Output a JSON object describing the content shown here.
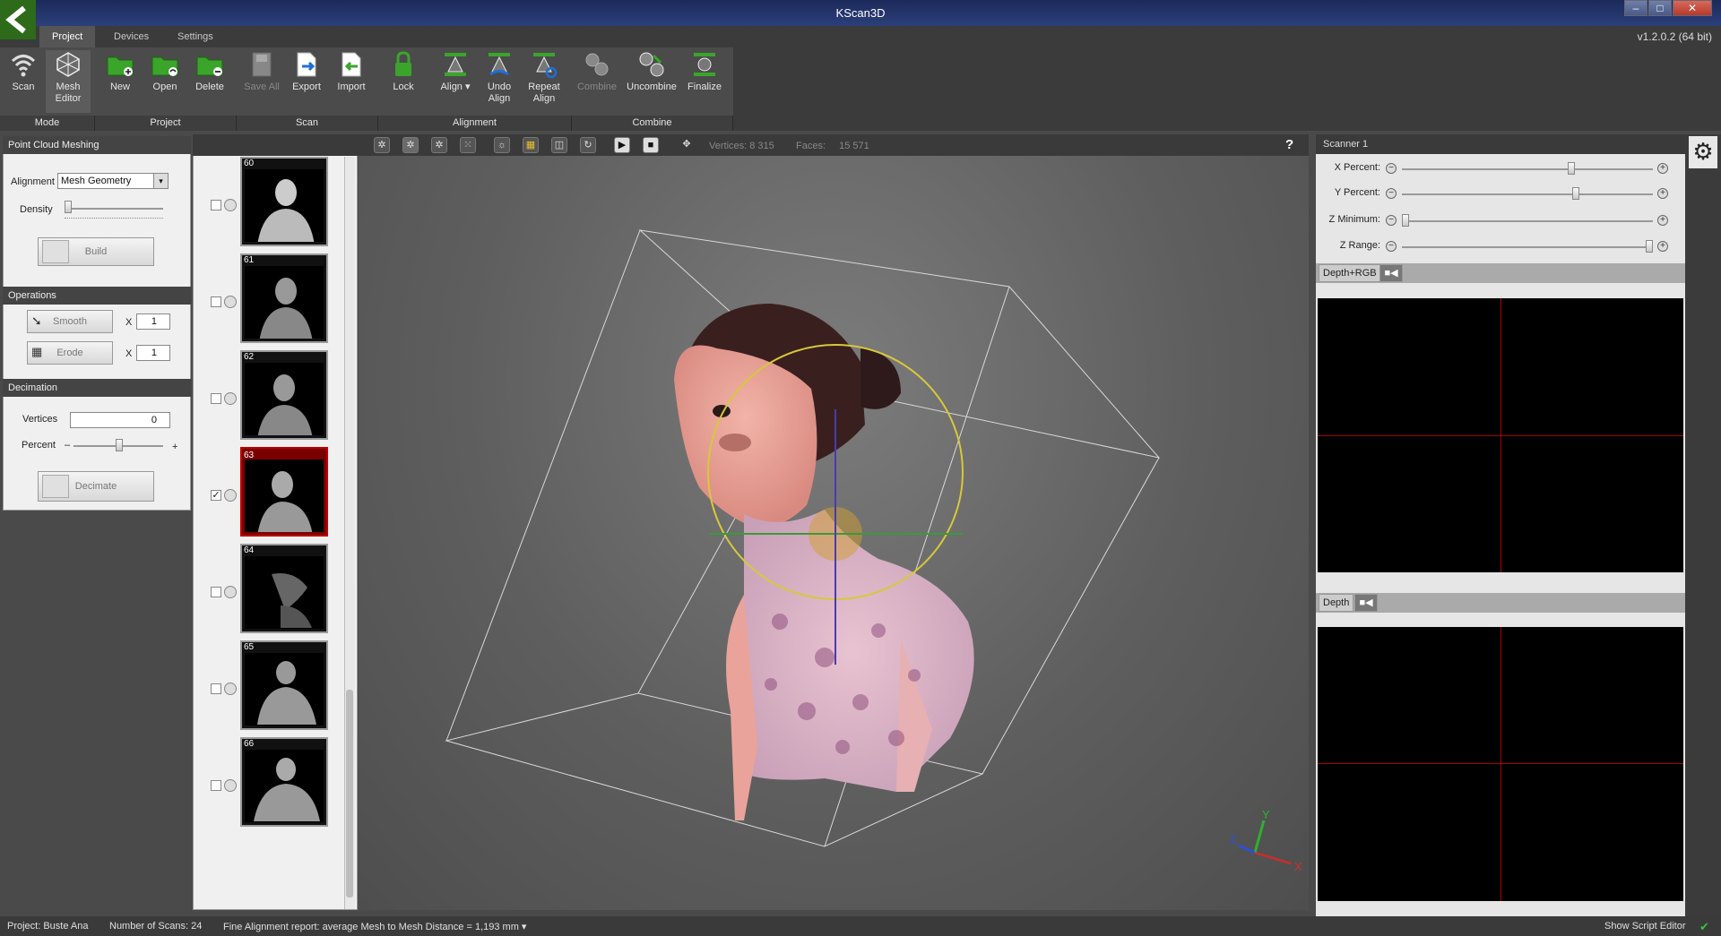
{
  "window": {
    "title": "KScan3D",
    "version": "v1.2.0.2 (64 bit)",
    "controls": [
      "–",
      "□",
      "✕"
    ]
  },
  "tabs": [
    {
      "label": "Project"
    },
    {
      "label": "Devices"
    },
    {
      "label": "Settings"
    }
  ],
  "ribbon": {
    "buttons": [
      {
        "label": "Scan",
        "icon": "wifi-icon"
      },
      {
        "label": "Mesh Editor",
        "icon": "mesh-icon"
      },
      {
        "label": "New",
        "icon": "folder-new-icon"
      },
      {
        "label": "Open",
        "icon": "folder-open-icon"
      },
      {
        "label": "Delete",
        "icon": "folder-delete-icon"
      },
      {
        "label": "Save All",
        "icon": "save-icon"
      },
      {
        "label": "Export",
        "icon": "export-icon"
      },
      {
        "label": "Import",
        "icon": "import-icon"
      },
      {
        "label": "Lock",
        "icon": "lock-icon"
      },
      {
        "label": "Align ▾",
        "icon": "align-icon"
      },
      {
        "label": "Undo Align",
        "icon": "undo-align-icon"
      },
      {
        "label": "Repeat Align",
        "icon": "repeat-align-icon"
      },
      {
        "label": "Combine",
        "icon": "combine-icon"
      },
      {
        "label": "Uncombine",
        "icon": "uncombine-icon"
      },
      {
        "label": "Finalize",
        "icon": "finalize-icon"
      }
    ],
    "groups": [
      "Mode",
      "Project",
      "Scan",
      "Alignment",
      "Combine"
    ]
  },
  "meshing": {
    "header": "Point Cloud Meshing",
    "alignment_label": "Alignment",
    "alignment_value": "Mesh Geometry",
    "density_label": "Density",
    "build_label": "Build"
  },
  "operations": {
    "header": "Operations",
    "smooth_label": "Smooth",
    "erode_label": "Erode",
    "x": "X",
    "smooth_count": "1",
    "erode_count": "1"
  },
  "decimation": {
    "header": "Decimation",
    "vertices_label": "Vertices",
    "vertices_value": "0",
    "percent_label": "Percent",
    "minus": "–",
    "plus": "+",
    "decimate_label": "Decimate"
  },
  "scans": [
    {
      "num": "60",
      "checked": false
    },
    {
      "num": "61",
      "checked": false
    },
    {
      "num": "62",
      "checked": false
    },
    {
      "num": "63",
      "checked": true
    },
    {
      "num": "64",
      "checked": false
    },
    {
      "num": "65",
      "checked": false
    },
    {
      "num": "66",
      "checked": false
    }
  ],
  "viewport": {
    "vertices_label": "Vertices:",
    "vertices_value": "8 315",
    "faces_label": "Faces:",
    "faces_value": "15 571",
    "help": "?",
    "axes": {
      "x": "X",
      "y": "Y",
      "z": "Z"
    }
  },
  "scanner": {
    "header": "Scanner 1",
    "sliders": [
      {
        "label": "X Percent:",
        "value": 0.68
      },
      {
        "label": "Y Percent:",
        "value": 0.7
      },
      {
        "label": "Z Minimum:",
        "value": 0.0
      },
      {
        "label": "Z Range:",
        "value": 1.0
      }
    ],
    "view1_label": "Depth+RGB",
    "view2_label": "Depth"
  },
  "status": {
    "project": "Project:  Buste Ana",
    "scans": "Number of Scans:  24",
    "report": "Fine Alignment report: average Mesh to Mesh Distance = 1,193 mm ▾",
    "script_editor": "Show Script Editor"
  }
}
